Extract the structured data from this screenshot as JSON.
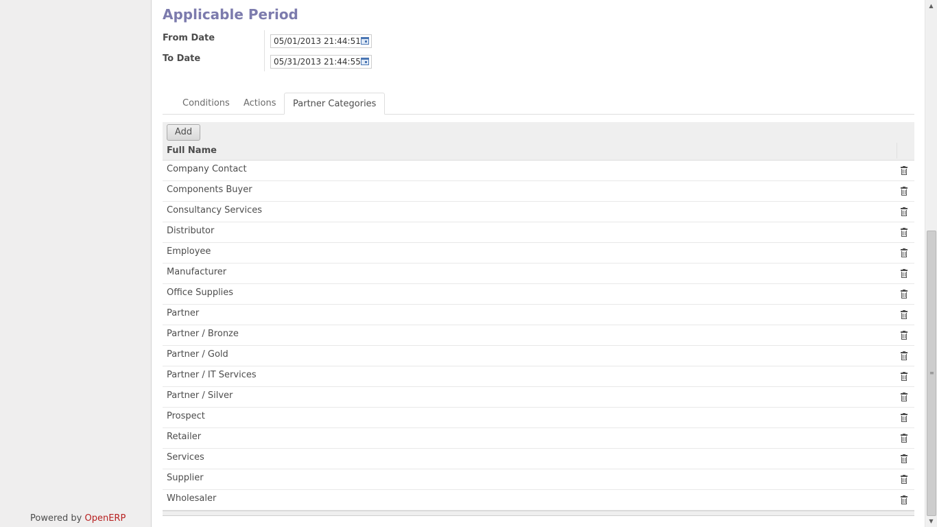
{
  "footer": {
    "powered_by": "Powered by",
    "brand": "OpenERP"
  },
  "form": {
    "section_title": "Applicable Period",
    "from_date_label": "From Date",
    "from_date_value": "05/01/2013 21:44:51",
    "to_date_label": "To Date",
    "to_date_value": "05/31/2013 21:44:55"
  },
  "tabs": [
    {
      "label": "Conditions",
      "active": false
    },
    {
      "label": "Actions",
      "active": false
    },
    {
      "label": "Partner Categories",
      "active": true
    }
  ],
  "list": {
    "add_label": "Add",
    "column_header": "Full Name",
    "rows": [
      "Company Contact",
      "Components Buyer",
      "Consultancy Services",
      "Distributor",
      "Employee",
      "Manufacturer",
      "Office Supplies",
      "Partner",
      "Partner / Bronze",
      "Partner / Gold",
      "Partner / IT Services",
      "Partner / Silver",
      "Prospect",
      "Retailer",
      "Services",
      "Supplier",
      "Wholesaler"
    ],
    "row_icon": "trash-icon"
  },
  "colors": {
    "section_title": "#7c7bad",
    "brand": "#b71f1f"
  }
}
